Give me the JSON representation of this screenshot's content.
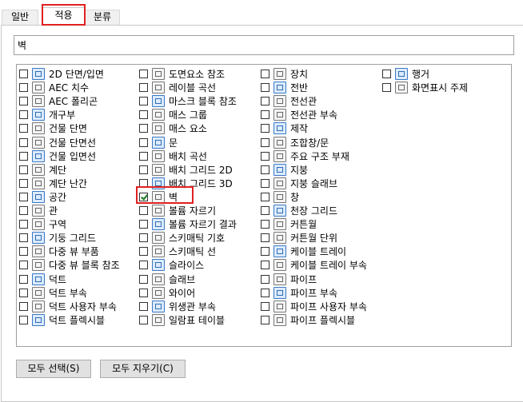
{
  "tabs": [
    "일반",
    "적용",
    "분류"
  ],
  "search": {
    "value": "벽"
  },
  "columns": [
    [
      {
        "label": "2D 단면/입면",
        "checked": false
      },
      {
        "label": "AEC 치수",
        "checked": false
      },
      {
        "label": "AEC 폴리곤",
        "checked": false
      },
      {
        "label": "개구부",
        "checked": false
      },
      {
        "label": "건물 단면",
        "checked": false
      },
      {
        "label": "건물 단면선",
        "checked": false
      },
      {
        "label": "건물 입면선",
        "checked": false
      },
      {
        "label": "계단",
        "checked": false
      },
      {
        "label": "계단 난간",
        "checked": false
      },
      {
        "label": "공간",
        "checked": false
      },
      {
        "label": "관",
        "checked": false
      },
      {
        "label": "구역",
        "checked": false
      },
      {
        "label": "기둥 그리드",
        "checked": false
      },
      {
        "label": "다중 뷰 부품",
        "checked": false
      },
      {
        "label": "다중 뷰 블록 참조",
        "checked": false
      },
      {
        "label": "덕트",
        "checked": false
      },
      {
        "label": "덕트 부속",
        "checked": false
      },
      {
        "label": "덕트 사용자 부속",
        "checked": false
      },
      {
        "label": "덕트 플렉시블",
        "checked": false
      }
    ],
    [
      {
        "label": "도면요소 참조",
        "checked": false
      },
      {
        "label": "레이블 곡선",
        "checked": false
      },
      {
        "label": "마스크 블록 참조",
        "checked": false
      },
      {
        "label": "매스 그룹",
        "checked": false
      },
      {
        "label": "매스 요소",
        "checked": false
      },
      {
        "label": "문",
        "checked": false
      },
      {
        "label": "배치 곡선",
        "checked": false
      },
      {
        "label": "배치 그리드 2D",
        "checked": false
      },
      {
        "label": "배치 그리드 3D",
        "checked": false
      },
      {
        "label": "벽",
        "checked": true
      },
      {
        "label": "볼륨 자르기",
        "checked": false
      },
      {
        "label": "볼륨 자르기 결과",
        "checked": false
      },
      {
        "label": "스키매틱 기호",
        "checked": false
      },
      {
        "label": "스키매틱 선",
        "checked": false
      },
      {
        "label": "슬라이스",
        "checked": false
      },
      {
        "label": "슬래브",
        "checked": false
      },
      {
        "label": "와이어",
        "checked": false
      },
      {
        "label": "위생관 부속",
        "checked": false
      },
      {
        "label": "일람표 테이블",
        "checked": false
      }
    ],
    [
      {
        "label": "장치",
        "checked": false
      },
      {
        "label": "전반",
        "checked": false
      },
      {
        "label": "전선관",
        "checked": false
      },
      {
        "label": "전선관 부속",
        "checked": false
      },
      {
        "label": "제작",
        "checked": false
      },
      {
        "label": "조합창/문",
        "checked": false
      },
      {
        "label": "주요 구조 부재",
        "checked": false
      },
      {
        "label": "지붕",
        "checked": false
      },
      {
        "label": "지붕 슬래브",
        "checked": false
      },
      {
        "label": "창",
        "checked": false
      },
      {
        "label": "천장 그리드",
        "checked": false
      },
      {
        "label": "커튼월",
        "checked": false
      },
      {
        "label": "커튼월 단위",
        "checked": false
      },
      {
        "label": "케이블 트레이",
        "checked": false
      },
      {
        "label": "케이블 트레이 부속",
        "checked": false
      },
      {
        "label": "파이프",
        "checked": false
      },
      {
        "label": "파이프 부속",
        "checked": false
      },
      {
        "label": "파이프 사용자 부속",
        "checked": false
      },
      {
        "label": "파이프 플렉시블",
        "checked": false
      }
    ],
    [
      {
        "label": "행거",
        "checked": false
      },
      {
        "label": "화면표시 주제",
        "checked": false
      }
    ]
  ],
  "buttons": {
    "select_all": "모두 선택(S)",
    "clear_all": "모두 지우기(C)"
  }
}
